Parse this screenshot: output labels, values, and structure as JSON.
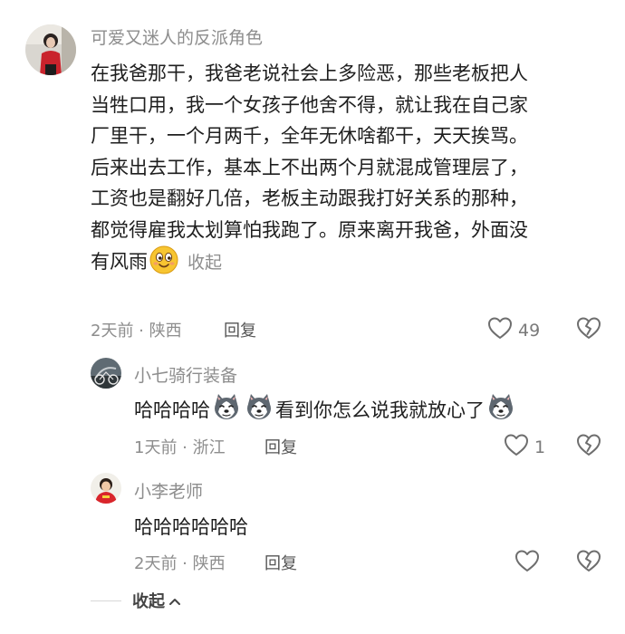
{
  "comment": {
    "username": "可爱又迷人的反派角色",
    "lines": [
      "在我爸那干，我爸老说社会上多险恶，那些老板把人",
      "当牲口用，我一个女孩子他舍不得，就让我在自己家",
      "厂里干，一个月两千，全年无休啥都干，天天挨骂。",
      "后来出去工作，基本上不出两个月就混成管理层了，",
      "工资也是翻好几倍，老板主动跟我打好关系的那种，",
      "都觉得雇我太划算怕我跑了。原来离开我爸，外面没",
      "有风雨"
    ],
    "collapse_label": "收起",
    "time_location": "2天前 · 陕西",
    "reply_label": "回复",
    "like_count": "49"
  },
  "replies": [
    {
      "username": "小七骑行装备",
      "text_before": "哈哈哈哈",
      "text_middle": "看到你怎么说我就放心了",
      "time_location": "1天前 · 浙江",
      "reply_label": "回复",
      "like_count": "1"
    },
    {
      "username": "小李老师",
      "text": "哈哈哈哈哈哈",
      "time_location": "2天前 · 陕西",
      "reply_label": "回复",
      "like_count": ""
    }
  ],
  "footer": {
    "collapse_label": "收起"
  },
  "icons": {
    "like": "heart-outline-icon",
    "dislike": "broken-heart-icon",
    "emoji": "smiling-face-icon",
    "sticker": "husky-dog-face-icon",
    "chevron": "chevron-up-icon"
  },
  "colors": {
    "text": "#1e1e1e",
    "muted": "#8d8d8d",
    "icon": "#6e6e6e"
  }
}
